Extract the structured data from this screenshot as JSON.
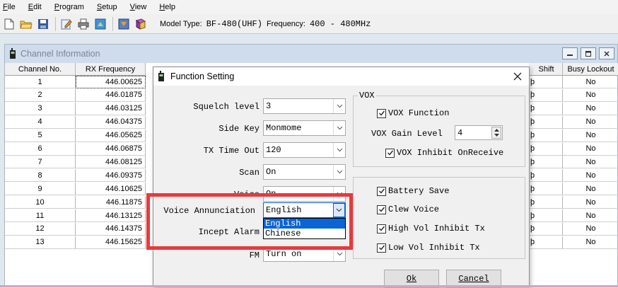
{
  "menu": [
    {
      "label": "File",
      "key": "F"
    },
    {
      "label": "Edit",
      "key": "E"
    },
    {
      "label": "Program",
      "key": "P"
    },
    {
      "label": "Setup",
      "key": "S"
    },
    {
      "label": "View",
      "key": "V"
    },
    {
      "label": "Help",
      "key": "H"
    }
  ],
  "toolbar": {
    "model_label": "Model Type:",
    "model_value": "BF-480(UHF)",
    "freq_label": "Frequency:",
    "freq_value": "400 - 480MHz",
    "icons": [
      "new-file-icon",
      "open-folder-icon",
      "save-icon",
      "edit-icon",
      "print-icon",
      "read-radio-icon",
      "write-radio-icon",
      "book-icon"
    ]
  },
  "channel_window": {
    "title": "Channel Information",
    "columns": [
      "Channel No.",
      "RX Frequency",
      "Shift",
      "Busy Lockout"
    ],
    "rows": [
      {
        "no": "1",
        "rx": "446.00625",
        "shift": "þ",
        "busy": "No"
      },
      {
        "no": "2",
        "rx": "446.01875",
        "shift": "þ",
        "busy": "No"
      },
      {
        "no": "3",
        "rx": "446.03125",
        "shift": "þ",
        "busy": "No"
      },
      {
        "no": "4",
        "rx": "446.04375",
        "shift": "þ",
        "busy": "No"
      },
      {
        "no": "5",
        "rx": "446.05625",
        "shift": "þ",
        "busy": "No"
      },
      {
        "no": "6",
        "rx": "446.06875",
        "shift": "þ",
        "busy": "No"
      },
      {
        "no": "7",
        "rx": "446.08125",
        "shift": "þ",
        "busy": "No"
      },
      {
        "no": "8",
        "rx": "446.09375",
        "shift": "þ",
        "busy": "No"
      },
      {
        "no": "9",
        "rx": "446.10625",
        "shift": "þ",
        "busy": "No"
      },
      {
        "no": "10",
        "rx": "446.11875",
        "shift": "þ",
        "busy": "No"
      },
      {
        "no": "11",
        "rx": "446.13125",
        "shift": "þ",
        "busy": "No"
      },
      {
        "no": "12",
        "rx": "446.14375",
        "shift": "þ",
        "busy": "No"
      },
      {
        "no": "13",
        "rx": "446.15625",
        "shift": "þ",
        "busy": "No"
      }
    ]
  },
  "dialog": {
    "title": "Function Setting",
    "fields": [
      {
        "label": "Squelch level",
        "value": "3"
      },
      {
        "label": "Side Key",
        "value": "Monmome"
      },
      {
        "label": "TX Time Out",
        "value": "120"
      },
      {
        "label": "Scan",
        "value": "On"
      },
      {
        "label": "Voice",
        "value": "On"
      },
      {
        "label": "Voice Annunciation",
        "value": "English"
      },
      {
        "label": "Incept Alarm",
        "value": ""
      },
      {
        "label": "FM",
        "value": "Turn on"
      }
    ],
    "voice_options": [
      "English",
      "Chinese"
    ],
    "vox": {
      "title": "VOX",
      "function_label": "VOX Function",
      "gain_label": "VOX Gain Level",
      "gain_value": "4",
      "inhibit_label": "VOX Inhibit OnReceive"
    },
    "checks": [
      {
        "label": "Battery Save",
        "checked": true
      },
      {
        "label": "Clew Voice",
        "checked": true
      },
      {
        "label": "High Vol Inhibit Tx",
        "checked": true
      },
      {
        "label": "Low Vol Inhibit Tx",
        "checked": true
      }
    ],
    "ok_label": "Ok",
    "cancel_label": "Cancel"
  },
  "colors": {
    "highlight": "#e8393d",
    "selection": "#0a64d6"
  }
}
